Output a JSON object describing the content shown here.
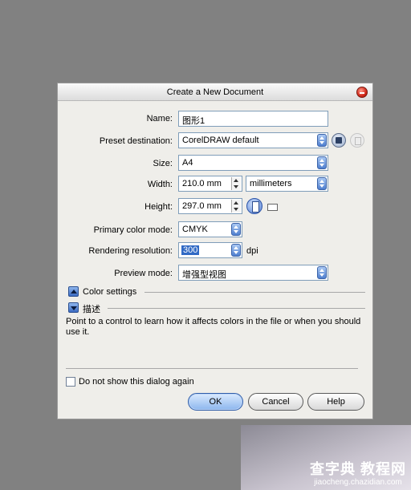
{
  "dialog": {
    "title": "Create a New Document",
    "name_label": "Name:",
    "name_value": "图形1",
    "preset_label": "Preset destination:",
    "preset_value": "CorelDRAW default",
    "size_label": "Size:",
    "size_value": "A4",
    "width_label": "Width:",
    "width_value": "210.0 mm",
    "units_value": "millimeters",
    "height_label": "Height:",
    "height_value": "297.0 mm",
    "color_mode_label": "Primary color mode:",
    "color_mode_value": "CMYK",
    "resolution_label": "Rendering resolution:",
    "resolution_value": "300",
    "resolution_unit": "dpi",
    "preview_label": "Preview mode:",
    "preview_value": "增强型视图",
    "color_settings_label": "Color settings",
    "description_label": "描述",
    "description_text": "Point to a control to learn how it affects colors in the file or when you should use it.",
    "dont_show_label": "Do not show this dialog again",
    "ok_label": "OK",
    "cancel_label": "Cancel",
    "help_label": "Help"
  },
  "watermark": {
    "cn": "查字典 教程网",
    "url": "jiaocheng.chazidian.com"
  },
  "colors": {
    "background": "#818181",
    "dialog": "#efeeea",
    "accent_blue": "#3b6bc2",
    "close_red": "#d2281a"
  }
}
